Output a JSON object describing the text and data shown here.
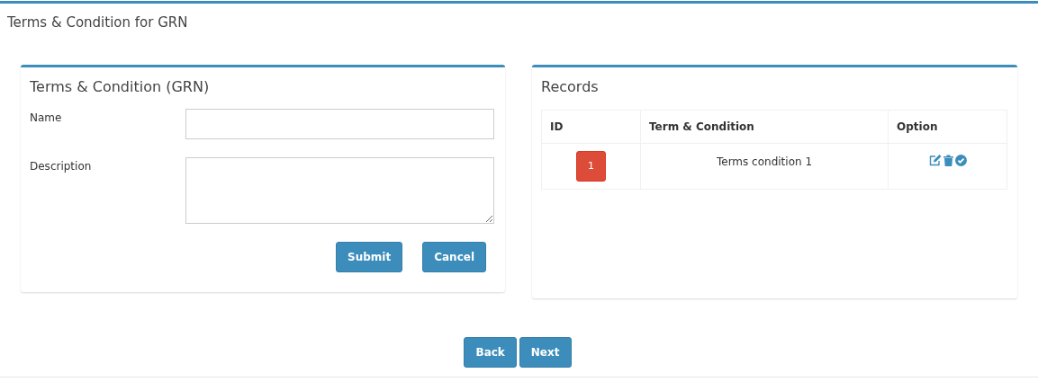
{
  "page_title": "Terms & Condition for GRN",
  "form": {
    "title": "Terms & Condition (GRN)",
    "fields": [
      {
        "label": "Name",
        "kind": "text"
      },
      {
        "label": "Description",
        "kind": "textarea"
      }
    ],
    "buttons": [
      "Submit",
      "Cancel"
    ]
  },
  "records": {
    "title": "Records",
    "columns": [
      "ID",
      "Term & Condition",
      "Option"
    ],
    "rows": [
      {
        "id": "1",
        "term": "Terms condition 1"
      }
    ]
  },
  "nav_buttons": [
    "Back",
    "Next"
  ]
}
